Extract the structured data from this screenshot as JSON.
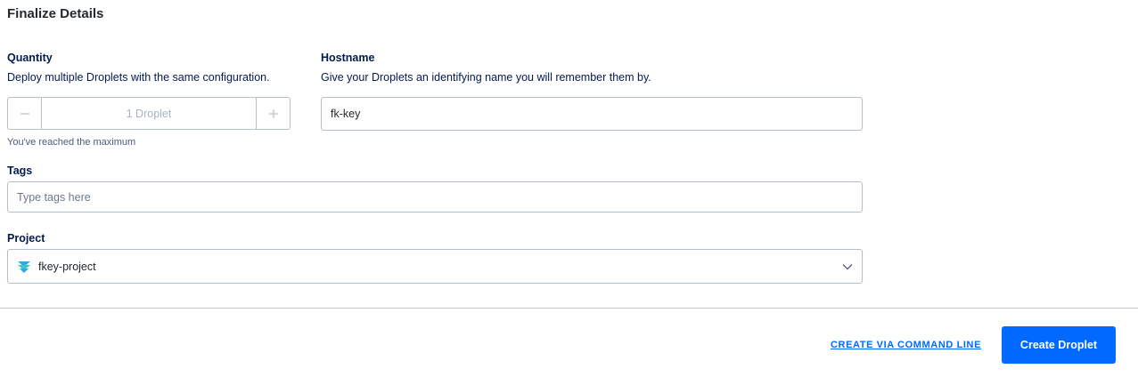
{
  "section": {
    "title": "Finalize Details"
  },
  "quantity": {
    "label": "Quantity",
    "description": "Deploy multiple Droplets with the same configuration.",
    "value": "1 Droplet",
    "hint": "You've reached the maximum",
    "decrement_icon": "minus-icon",
    "increment_icon": "plus-icon"
  },
  "hostname": {
    "label": "Hostname",
    "description": "Give your Droplets an identifying name you will remember them by.",
    "value": "fk-key"
  },
  "tags": {
    "label": "Tags",
    "placeholder": "Type tags here"
  },
  "project": {
    "label": "Project",
    "selected": "fkey-project",
    "icon": "project-layers-icon",
    "dropdown_icon": "chevron-down-icon"
  },
  "actions": {
    "cli_link": "CREATE VIA COMMAND LINE",
    "create_button": "Create Droplet"
  },
  "colors": {
    "primary": "#0069ff",
    "text": "#031b4e",
    "border": "#b5bfcb"
  }
}
